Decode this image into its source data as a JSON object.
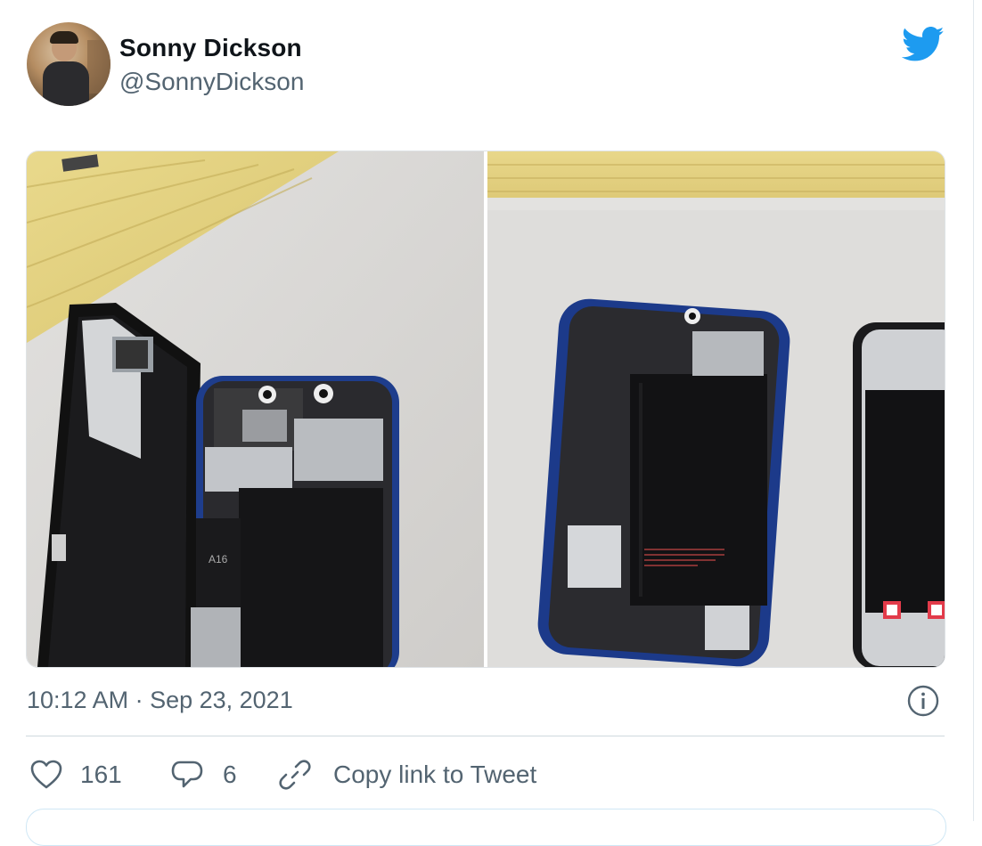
{
  "tweet": {
    "author_name": "Sonny Dickson",
    "author_handle": "@SonnyDickson",
    "timestamp": "10:12 AM · Sep 23, 2021",
    "likes": "161",
    "replies": "6",
    "copy_link_label": "Copy link to Tweet",
    "chip_label": "A16"
  },
  "icons": {
    "brand": "twitter-bird-icon",
    "info": "info-icon",
    "like": "heart-icon",
    "reply": "speech-bubble-icon",
    "copy": "link-icon"
  },
  "colors": {
    "brand_blue": "#1d9bf0",
    "text_primary": "#0f1419",
    "text_secondary": "#536471",
    "divider": "#cfd9de"
  }
}
